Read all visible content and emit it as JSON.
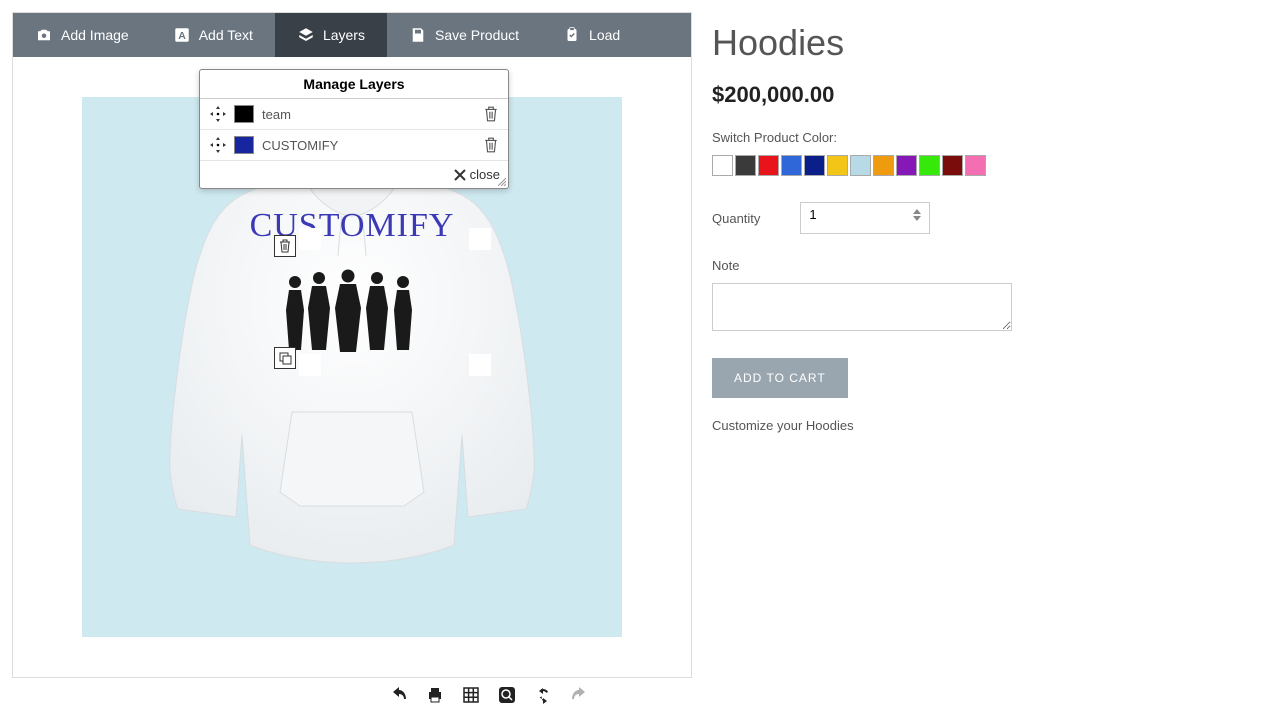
{
  "toolbar": {
    "addImage": "Add Image",
    "addText": "Add Text",
    "layers": "Layers",
    "save": "Save Product",
    "load": "Load"
  },
  "layersPanel": {
    "title": "Manage Layers",
    "items": [
      {
        "name": "team",
        "color": "#000000"
      },
      {
        "name": "CUSTOMIFY",
        "color": "#17259e"
      }
    ],
    "close": "close"
  },
  "design": {
    "text": "CUSTOMIFY"
  },
  "product": {
    "title": "Hoodies",
    "price": "$200,000.00",
    "switchLabel": "Switch Product Color:",
    "colors": [
      "#ffffff",
      "#3a3a3a",
      "#e9131b",
      "#2f66d8",
      "#0b1f8a",
      "#f3c516",
      "#b7dae6",
      "#ef9b0f",
      "#8518b6",
      "#37e80b",
      "#7a0c0c",
      "#f36fb2"
    ],
    "qtyLabel": "Quantity",
    "qtyValue": "1",
    "noteLabel": "Note",
    "cart": "ADD TO CART",
    "desc": "Customize your Hoodies"
  }
}
